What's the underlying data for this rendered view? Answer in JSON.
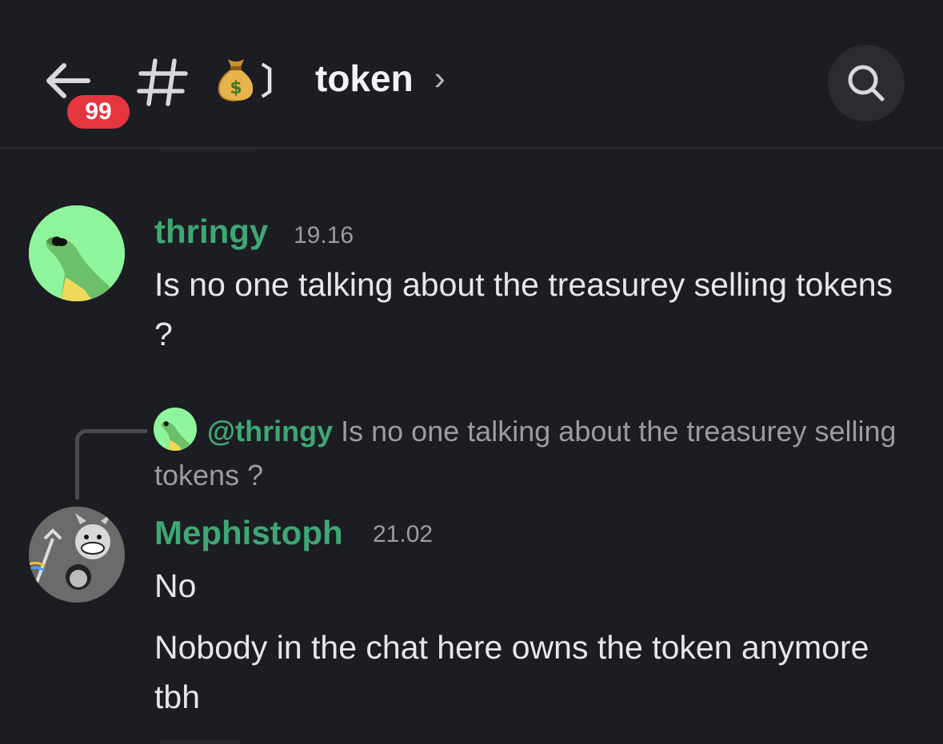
{
  "header": {
    "back_icon": "arrow-left-icon",
    "unread_count": "99",
    "channel_hash_icon": "hash-icon",
    "channel_emoji": "money-bag-icon",
    "channel_bracket": "〕",
    "channel_title": "token",
    "chevron": "›",
    "search_icon": "search-icon"
  },
  "messages": [
    {
      "username": "thringy",
      "time": "19.16",
      "text": "Is no one talking about the treasurey selling tokens ?",
      "avatar": "frog-avatar"
    },
    {
      "reply_to": {
        "mention": "@thringy",
        "text": "Is no one talking about the treasurey selling tokens ?"
      },
      "username": "Mephistoph",
      "time": "21.02",
      "lines": [
        "No",
        "Nobody in the chat here owns the token anymore tbh"
      ],
      "avatar": "devil-avatar"
    }
  ],
  "colors": {
    "background": "#1c1d22",
    "username": "#3ea874",
    "badge": "#e5353f"
  }
}
